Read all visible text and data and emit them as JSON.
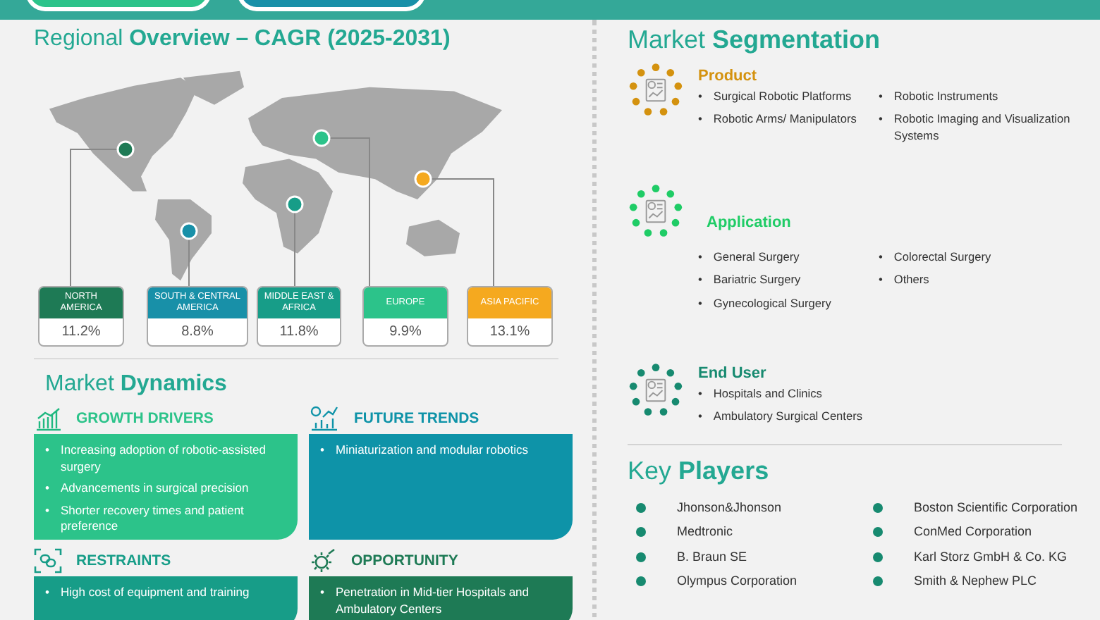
{
  "regional_overview": {
    "title": "Regional **Overview – CAGR (2025-2031)**",
    "regions": [
      {
        "name": "NORTH AMERICA",
        "value": "11.2%",
        "color": "#1e7a55"
      },
      {
        "name": "SOUTH & CENTRAL AMERICA",
        "value": "8.8%",
        "color": "#1890a8"
      },
      {
        "name": "MIDDLE EAST & AFRICA",
        "value": "11.8%",
        "color": "#179d88"
      },
      {
        "name": "EUROPE",
        "value": "9.9%",
        "color": "#2cc38a"
      },
      {
        "name": "ASIA PACIFIC",
        "value": "13.1%",
        "color": "#f5a91f"
      }
    ]
  },
  "market_dynamics": {
    "title": "Market **Dynamics**",
    "cards": [
      {
        "title": "GROWTH DRIVERS",
        "bullet": "•",
        "kind": "growth",
        "color": "#2cc38a",
        "items": [
          "Increasing adoption of robotic-assisted surgery",
          "Advancements in surgical precision",
          "Shorter recovery times and patient preference"
        ]
      },
      {
        "title": "FUTURE TRENDS",
        "bullet": "•",
        "kind": "trends",
        "color": "#0e93a8",
        "items": [
          "Miniaturization and modular robotics"
        ]
      },
      {
        "title": "RESTRAINTS",
        "bullet": "•",
        "kind": "restraints",
        "color": "#179d88",
        "items": [
          "High cost of equipment and training"
        ]
      },
      {
        "title": "OPPORTUNITY",
        "bullet": "•",
        "kind": "opportunity",
        "color": "#1e7a55",
        "items": [
          "Penetration in Mid-tier Hospitals and Ambulatory Centers"
        ]
      }
    ]
  },
  "market_segmentation": {
    "title": "Market **Segmentation**",
    "segments": [
      {
        "title": "Product",
        "bullet": "•",
        "color": "#d4920f",
        "items": [
          "Surgical Robotic Platforms",
          "Robotic Instruments",
          "Robotic Arms/ Manipulators",
          "Robotic Imaging and Visualization Systems"
        ]
      },
      {
        "title": "Application",
        "bullet": "•",
        "color": "#1fcc66",
        "items": [
          "General Surgery",
          "Colorectal Surgery",
          "Bariatric Surgery",
          "Others",
          "Gynecological Surgery"
        ]
      },
      {
        "title": "End User",
        "bullet": "•",
        "color": "#178a70",
        "items": [
          "Hospitals and Clinics",
          "Ambulatory Surgical Centers"
        ]
      }
    ]
  },
  "key_players": {
    "title": "Key **Players**",
    "players": [
      "Jhonson&Jhonson",
      "Boston Scientific Corporation",
      "Medtronic",
      "ConMed Corporation",
      "B. Braun SE",
      "Karl Storz GmbH & Co. KG",
      "Olympus Corporation",
      "Smith & Nephew PLC"
    ]
  }
}
